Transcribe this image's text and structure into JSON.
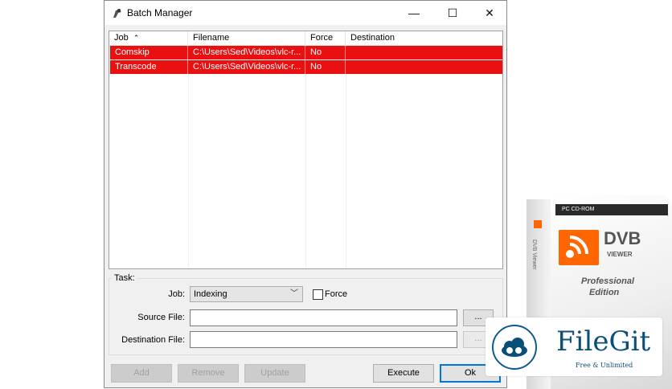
{
  "window": {
    "title": "Batch Manager",
    "controls": {
      "minimize": "—",
      "maximize": "☐",
      "close": "✕"
    }
  },
  "list": {
    "columns": [
      "Job",
      "Filename",
      "Force",
      "Destination"
    ],
    "sort_column": "Job",
    "rows": [
      {
        "job": "Comskip",
        "filename": "C:\\Users\\Sed\\Videos\\vlc-r...",
        "force": "No",
        "destination": ""
      },
      {
        "job": "Transcode",
        "filename": "C:\\Users\\Sed\\Videos\\vlc-r...",
        "force": "No",
        "destination": ""
      }
    ],
    "selection_color": "#e81010"
  },
  "task": {
    "group_label": "Task:",
    "job_label": "Job:",
    "job_value": "Indexing",
    "force_label": "Force",
    "force_checked": false,
    "source_label": "Source File:",
    "source_value": "",
    "destination_label": "Destination File:",
    "destination_value": "",
    "browse_label": "..."
  },
  "buttons": {
    "add": "Add",
    "remove": "Remove",
    "update": "Update",
    "execute": "Execute",
    "ok": "Ok"
  },
  "product_box": {
    "band": "PC CD-ROM",
    "brand": "DVB",
    "sub": "VIEWER",
    "side": "DVB Viewer",
    "line1": "Professional",
    "line2": "Edition"
  },
  "watermark": {
    "name": "FileGit",
    "tagline": "Free & Unlimited"
  }
}
